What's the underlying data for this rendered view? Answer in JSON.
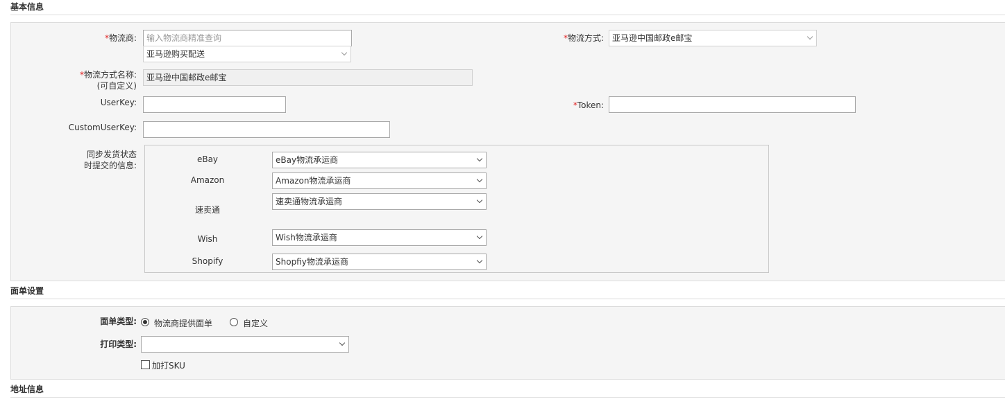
{
  "sections": {
    "basic": "基本信息",
    "label_settings": "面单设置",
    "address": "地址信息"
  },
  "basic": {
    "carrier": {
      "required_mark": "*",
      "label": "物流商:",
      "search_placeholder": "输入物流商精准查询",
      "selected": "亚马逊购买配送"
    },
    "method": {
      "required_mark": "*",
      "label": "物流方式:",
      "selected": "亚马逊中国邮政e邮宝"
    },
    "method_name": {
      "required_mark": "*",
      "label": "物流方式名称:",
      "label_sub": "(可自定义)",
      "value": "亚马逊中国邮政e邮宝"
    },
    "userkey": {
      "label": "UserKey:",
      "value": ""
    },
    "token": {
      "required_mark": "*",
      "label": "Token:",
      "value": ""
    },
    "custom_userkey": {
      "label": "CustomUserKey:",
      "value": ""
    },
    "sync": {
      "label_line1": "同步发货状态",
      "label_line2": "时提交的信息:",
      "platforms": [
        {
          "name": "eBay",
          "selected": "eBay物流承运商"
        },
        {
          "name": "Amazon",
          "selected": "Amazon物流承运商"
        },
        {
          "name": "速卖通",
          "selected": "速卖通物流承运商"
        },
        {
          "name": "Wish",
          "selected": "Wish物流承运商"
        },
        {
          "name": "Shopify",
          "selected": "Shopfiy物流承运商"
        }
      ]
    }
  },
  "label_settings": {
    "type_label": "面单类型:",
    "options": [
      "物流商提供面单",
      "自定义"
    ],
    "selected_option": "物流商提供面单",
    "print_label": "打印类型:",
    "print_value": "",
    "add_sku": "加打SKU",
    "add_sku_checked": false
  }
}
